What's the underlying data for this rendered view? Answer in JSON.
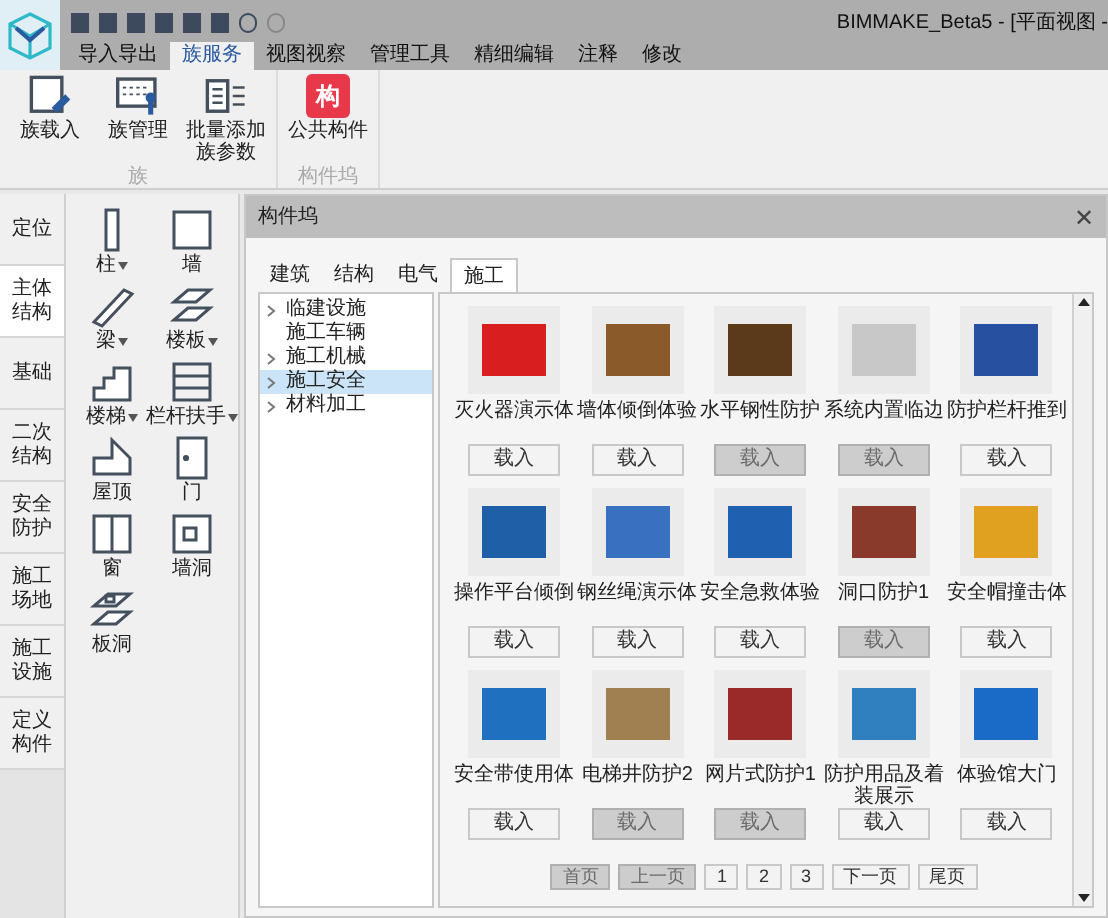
{
  "window": {
    "title": "BIMMAKE_Beta5 - [平面视图 -"
  },
  "ribbon_tabs": [
    {
      "label": "导入导出",
      "selected": false
    },
    {
      "label": "族服务",
      "selected": true
    },
    {
      "label": "视图视察",
      "selected": false
    },
    {
      "label": "管理工具",
      "selected": false
    },
    {
      "label": "精细编辑",
      "selected": false
    },
    {
      "label": "注释",
      "selected": false
    },
    {
      "label": "修改",
      "selected": false
    }
  ],
  "ribbon_groups": [
    {
      "label": "族",
      "buttons": [
        {
          "kind": "load",
          "label": "族载入"
        },
        {
          "kind": "manage",
          "label": "族管理"
        },
        {
          "kind": "params",
          "label": "批量添加族参数"
        }
      ]
    },
    {
      "label": "构件坞",
      "buttons": [
        {
          "kind": "badge",
          "icon_text": "构",
          "label": "公共构件"
        }
      ]
    }
  ],
  "side_tabs": [
    {
      "label": "定位",
      "selected": false
    },
    {
      "label": "主体结构",
      "selected": true
    },
    {
      "label": "基础",
      "selected": false
    },
    {
      "label": "二次结构",
      "selected": false
    },
    {
      "label": "安全防护",
      "selected": false
    },
    {
      "label": "施工场地",
      "selected": false
    },
    {
      "label": "施工设施",
      "selected": false
    },
    {
      "label": "定义构件",
      "selected": false
    }
  ],
  "tools": [
    {
      "kind": "column",
      "label": "柱",
      "has_menu": true
    },
    {
      "kind": "wall",
      "label": "墙",
      "has_menu": false
    },
    {
      "kind": "beam",
      "label": "梁",
      "has_menu": true
    },
    {
      "kind": "slab",
      "label": "楼板",
      "has_menu": true
    },
    {
      "kind": "stair",
      "label": "楼梯",
      "has_menu": true
    },
    {
      "kind": "railing",
      "label": "栏杆扶手",
      "has_menu": true
    },
    {
      "kind": "roof",
      "label": "屋顶",
      "has_menu": false
    },
    {
      "kind": "door",
      "label": "门",
      "has_menu": false
    },
    {
      "kind": "window",
      "label": "窗",
      "has_menu": false
    },
    {
      "kind": "wall_opening",
      "label": "墙洞",
      "has_menu": false
    },
    {
      "kind": "slab_opening",
      "label": "板洞",
      "has_menu": false
    }
  ],
  "panel": {
    "title": "构件坞",
    "close": "✕",
    "tabs": [
      {
        "label": "建筑",
        "selected": false
      },
      {
        "label": "结构",
        "selected": false
      },
      {
        "label": "电气",
        "selected": false
      },
      {
        "label": "施工",
        "selected": true
      }
    ],
    "tree": [
      {
        "label": "临建设施",
        "expandable": true,
        "selected": false
      },
      {
        "label": "施工车辆",
        "expandable": false,
        "selected": false
      },
      {
        "label": "施工机械",
        "expandable": true,
        "selected": false
      },
      {
        "label": "施工安全",
        "expandable": true,
        "selected": true
      },
      {
        "label": "材料加工",
        "expandable": true,
        "selected": false
      }
    ],
    "items": [
      {
        "name": "灭火器演示体",
        "button": "载入",
        "disabled": false
      },
      {
        "name": "墙体倾倒体验",
        "button": "载入",
        "disabled": false
      },
      {
        "name": "水平钢性防护",
        "button": "载入",
        "disabled": true
      },
      {
        "name": "系统内置临边",
        "button": "载入",
        "disabled": true
      },
      {
        "name": "防护栏杆推到",
        "button": "载入",
        "disabled": false
      },
      {
        "name": "操作平台倾倒",
        "button": "载入",
        "disabled": false
      },
      {
        "name": "钢丝绳演示体",
        "button": "载入",
        "disabled": false
      },
      {
        "name": "安全急救体验",
        "button": "载入",
        "disabled": false
      },
      {
        "name": "洞口防护1",
        "button": "载入",
        "disabled": true
      },
      {
        "name": "安全帽撞击体",
        "button": "载入",
        "disabled": false
      },
      {
        "name": "安全带使用体",
        "button": "载入",
        "disabled": false
      },
      {
        "name": "电梯井防护2",
        "button": "载入",
        "disabled": true
      },
      {
        "name": "网片式防护1",
        "button": "载入",
        "disabled": true
      },
      {
        "name": "防护用品及着装展示",
        "button": "载入",
        "disabled": false
      },
      {
        "name": "体验馆大门",
        "button": "载入",
        "disabled": false
      }
    ],
    "pagination": [
      {
        "label": "首页",
        "disabled": true
      },
      {
        "label": "上一页",
        "disabled": true
      },
      {
        "label": "1",
        "disabled": false
      },
      {
        "label": "2",
        "disabled": false
      },
      {
        "label": "3",
        "disabled": false
      },
      {
        "label": "下一页",
        "disabled": false
      },
      {
        "label": "尾页",
        "disabled": false
      }
    ]
  }
}
